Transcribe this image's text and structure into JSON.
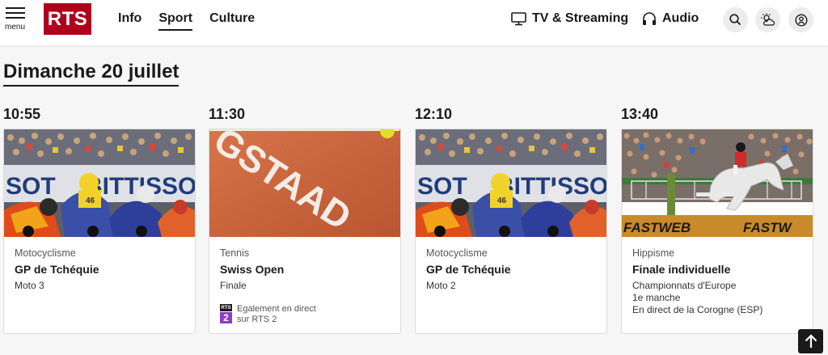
{
  "header": {
    "menu_label": "menu",
    "logo_text": "RTS",
    "nav": [
      {
        "label": "Info"
      },
      {
        "label": "Sport"
      },
      {
        "label": "Culture"
      }
    ],
    "tv_label": "TV & Streaming",
    "audio_label": "Audio",
    "icons": [
      "search-icon",
      "weather-icon",
      "account-icon"
    ]
  },
  "day_title": "Dimanche 20 juillet",
  "events": [
    {
      "time": "10:55",
      "discipline": "Motocyclisme",
      "title": "GP de Tchéquie",
      "subtitle": [
        "Moto 3"
      ],
      "image": "motogp-racers"
    },
    {
      "time": "11:30",
      "discipline": "Tennis",
      "title": "Swiss Open",
      "subtitle": [
        "Finale"
      ],
      "image": "gstaad-clay-court",
      "also_live": {
        "logo_top": "RTS",
        "logo_bottom": "2",
        "line1": "Egalement en direct",
        "line2": "sur RTS 2"
      }
    },
    {
      "time": "12:10",
      "discipline": "Motocyclisme",
      "title": "GP de Tchéquie",
      "subtitle": [
        "Moto 2"
      ],
      "image": "motogp-racers"
    },
    {
      "time": "13:40",
      "discipline": "Hippisme",
      "title": "Finale individuelle",
      "subtitle": [
        "Championnats d'Europe",
        "1e manche",
        "En direct de la Corogne (ESP)"
      ],
      "image": "show-jumping-horse"
    }
  ],
  "image_text": {
    "gstaad": "GSTAAD"
  },
  "colors": {
    "brand": "#af001e",
    "rts2_purple": "#8c3cc8",
    "background": "#f6f6f6"
  }
}
